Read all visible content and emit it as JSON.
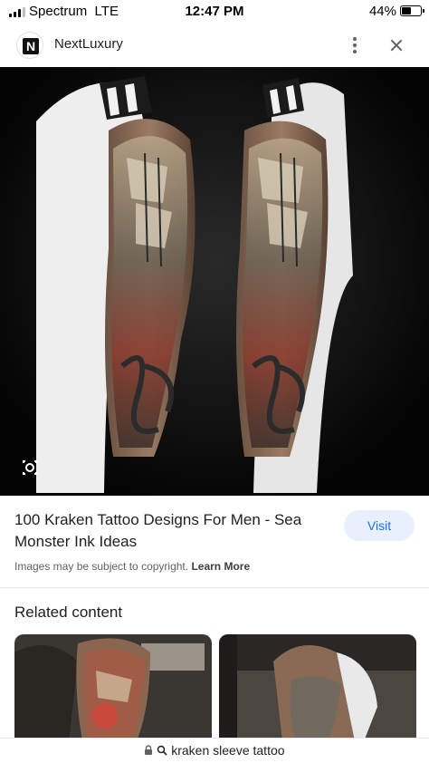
{
  "status_bar": {
    "carrier": "Spectrum",
    "network": "LTE",
    "time": "12:47 PM",
    "battery": "44%",
    "battery_level": 0.44
  },
  "source": {
    "favicon_letter": "N",
    "name": "NextLuxury"
  },
  "result": {
    "title": "100 Kraken Tattoo Designs For Men - Sea Monster Ink Ideas",
    "visit_label": "Visit",
    "copyright_text": "Images may be subject to copyright.",
    "learn_more": "Learn More"
  },
  "related": {
    "heading": "Related content"
  },
  "url_bar": {
    "query": "kraken sleeve tattoo"
  },
  "colors": {
    "accent": "#1a73e8",
    "visit_bg": "#e8f0fe",
    "image_bg": "#050505"
  }
}
